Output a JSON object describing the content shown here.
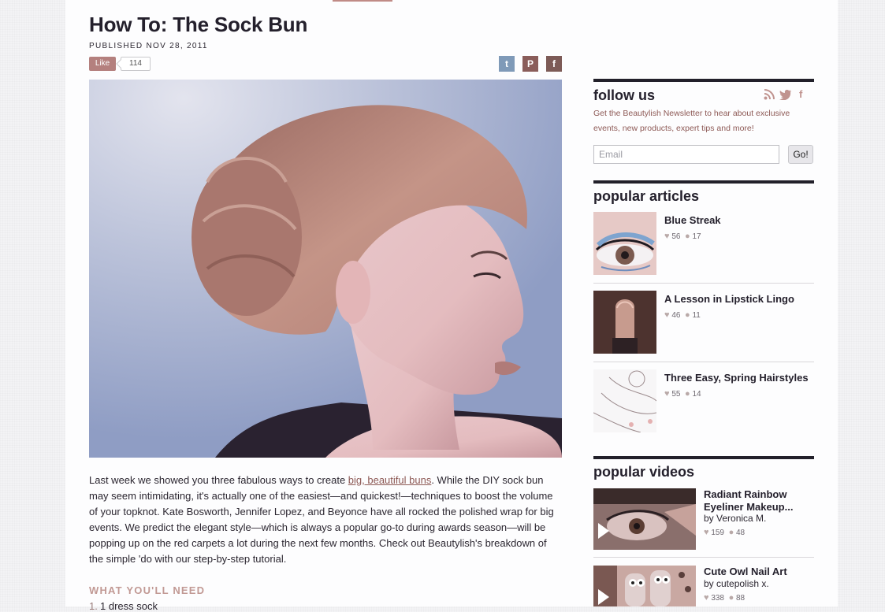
{
  "article": {
    "title": "How To: The Sock Bun",
    "published": "PUBLISHED NOV 28, 2011",
    "like_label": "Like",
    "like_count": "114",
    "body_part1": "Last week we showed you three fabulous ways to create ",
    "body_link": "big, beautiful buns",
    "body_part2": ". While the DIY sock bun may seem intimidating, it's actually one of the easiest—and quickest!—techniques to boost the volume of your topknot. Kate Bosworth, Jennifer Lopez, and Beyonce have all rocked the polished wrap for big events. We predict the elegant style—which is always a popular go-to during awards season—will be popping up on the red carpets a lot during the next few months. Check out Beautylish's breakdown of the simple 'do with our step-by-step tutorial.",
    "need_heading": "WHAT YOU'LL NEED",
    "need_item_num": "1.",
    "need_item": "1 dress sock"
  },
  "share": {
    "twitter_glyph": "t",
    "pinterest_glyph": "P",
    "facebook_glyph": "f"
  },
  "sidebar": {
    "follow": {
      "heading": "follow us",
      "icons": [
        "rss-icon",
        "twitter-icon",
        "facebook-icon"
      ],
      "newsletter_text": "Get the Beautylish Newsletter to hear about exclusive events, new products, expert tips and more!",
      "email_placeholder": "Email",
      "go_label": "Go!"
    },
    "popular_articles": {
      "heading": "popular articles",
      "items": [
        {
          "title": "Blue Streak",
          "likes": "56",
          "comments": "17"
        },
        {
          "title": "A Lesson in Lipstick Lingo",
          "likes": "46",
          "comments": "11"
        },
        {
          "title": "Three Easy, Spring Hairstyles",
          "likes": "55",
          "comments": "14"
        }
      ]
    },
    "popular_videos": {
      "heading": "popular videos",
      "items": [
        {
          "title_line1": "Radiant Rainbow",
          "title_line2": "Eyeliner Makeup...",
          "by": "by Veronica M.",
          "likes": "159",
          "comments": "48"
        },
        {
          "title_line1": "Cute Owl Nail Art",
          "title_line2": "",
          "by": "by cutepolish x.",
          "likes": "338",
          "comments": "88"
        }
      ]
    }
  },
  "colors": {
    "accent": "#b4807e",
    "link": "#8d5955",
    "heading_rule": "#22202a"
  }
}
